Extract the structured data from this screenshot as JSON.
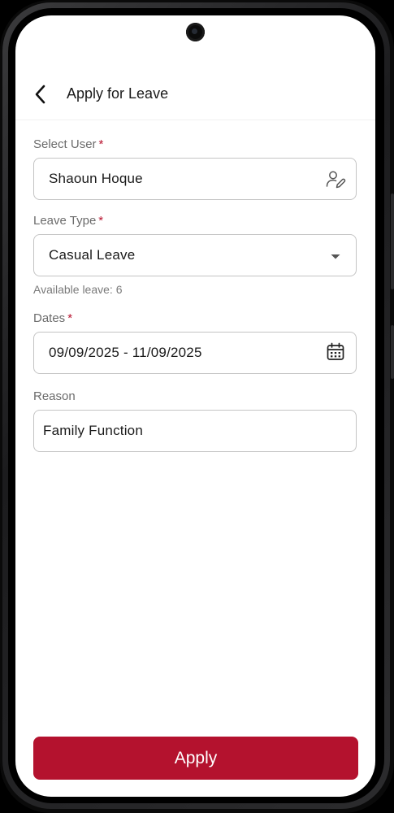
{
  "header": {
    "title": "Apply for Leave",
    "back_icon": "chevron-left-icon"
  },
  "form": {
    "select_user": {
      "label": "Select User",
      "required_mark": "*",
      "value": "Shaoun Hoque",
      "icon": "user-edit-icon"
    },
    "leave_type": {
      "label": "Leave Type",
      "required_mark": "*",
      "value": "Casual Leave",
      "icon": "dropdown-arrow-icon",
      "helper": "Available leave: 6"
    },
    "dates": {
      "label": "Dates",
      "required_mark": "*",
      "value": "09/09/2025 - 11/09/2025",
      "icon": "calendar-icon"
    },
    "reason": {
      "label": "Reason",
      "value": "Family Function"
    }
  },
  "actions": {
    "apply_label": "Apply"
  },
  "colors": {
    "accent": "#b4122e",
    "required": "#b8132f",
    "label": "#6b6b6b",
    "border": "#c4c4c4",
    "text": "#1a1a1a"
  }
}
